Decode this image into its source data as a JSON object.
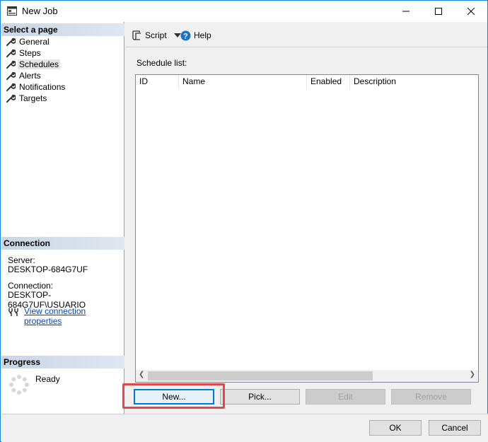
{
  "window": {
    "title": "New Job",
    "controls": {
      "minimize": "—",
      "maximize": "☐",
      "close": "✕"
    }
  },
  "left": {
    "select_page_header": "Select a page",
    "pages": [
      {
        "label": "General",
        "icon": "wrench-icon"
      },
      {
        "label": "Steps",
        "icon": "wrench-icon"
      },
      {
        "label": "Schedules",
        "icon": "wrench-icon",
        "selected": true
      },
      {
        "label": "Alerts",
        "icon": "wrench-icon"
      },
      {
        "label": "Notifications",
        "icon": "wrench-icon"
      },
      {
        "label": "Targets",
        "icon": "wrench-icon"
      }
    ],
    "connection_header": "Connection",
    "server_label": "Server:",
    "server_value": "DESKTOP-684G7UF",
    "connection_label": "Connection:",
    "connection_value": "DESKTOP-684G7UF\\USUARIO",
    "view_properties_link": "View connection properties",
    "progress_header": "Progress",
    "progress_status": "Ready"
  },
  "toolbar": {
    "script_label": "Script",
    "help_label": "Help"
  },
  "schedules": {
    "list_label": "Schedule list:",
    "columns": [
      "ID",
      "Name",
      "Enabled",
      "Description"
    ]
  },
  "buttons": {
    "new": "New...",
    "pick": "Pick...",
    "edit": "Edit",
    "remove": "Remove",
    "ok": "OK",
    "cancel": "Cancel"
  },
  "colors": {
    "accent": "#0078d7",
    "highlight": "#e04848",
    "link": "#0645ad"
  }
}
